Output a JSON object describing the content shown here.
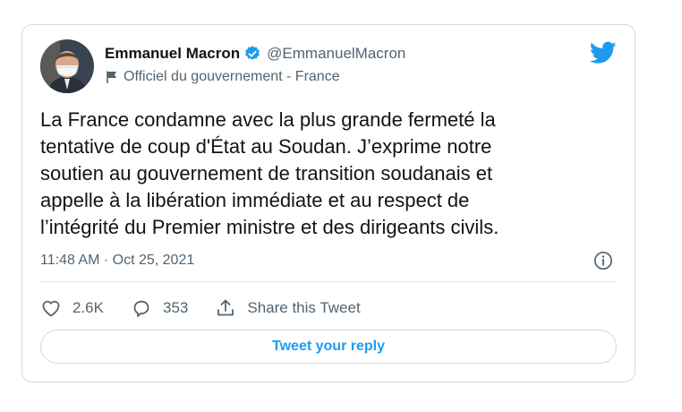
{
  "tweet": {
    "author_name": "Emmanuel Macron",
    "handle": "@EmmanuelMacron",
    "account_label": "Officiel du gouvernement - France",
    "text_lines": [
      "La France condamne avec la plus grande fermeté la",
      "tentative de coup d'État au Soudan. J’exprime notre",
      "soutien au gouvernement de transition soudanais et",
      "appelle à la libération immédiate et au respect de",
      "l’intégrité du Premier ministre et des dirigeants civils."
    ],
    "timestamp": "11:48 AM · Oct 25, 2021",
    "likes": "2.6K",
    "replies": "353",
    "share_label": "Share this Tweet",
    "reply_button": "Tweet your reply"
  },
  "colors": {
    "accent": "#1d9bf0",
    "text": "#0f1419",
    "secondary": "#536471",
    "border": "#cfd9de"
  },
  "icons": [
    "verified-badge-icon",
    "government-flag-icon",
    "twitter-bird-icon",
    "info-icon",
    "like-heart-icon",
    "reply-bubble-icon",
    "share-icon"
  ]
}
